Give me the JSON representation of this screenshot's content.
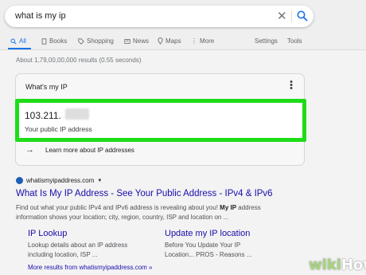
{
  "search": {
    "query": "what is my ip",
    "clear_glyph": "✕"
  },
  "tabs": [
    {
      "label": "All",
      "icon": "search-icon"
    },
    {
      "label": "Books",
      "icon": "book-icon"
    },
    {
      "label": "Shopping",
      "icon": "tag-icon"
    },
    {
      "label": "News",
      "icon": "news-icon"
    },
    {
      "label": "Maps",
      "icon": "map-pin-icon"
    },
    {
      "label": "More",
      "icon": "more-vert-icon"
    }
  ],
  "tools": {
    "settings": "Settings",
    "tools": "Tools"
  },
  "stats": "About 1,79,00,00,000 results (0.55 seconds)",
  "card": {
    "title": "What's my IP",
    "ip_prefix": "103.211.",
    "ip_label": "Your public IP address",
    "learn_more": "Learn more about IP addresses"
  },
  "result": {
    "site": "whatismyipaddress.com",
    "title": "What Is My IP Address - See Your Public Address - IPv4 & IPv6",
    "snippet_line1_a": "Find out what your public IPv4 and IPv6 address is revealing about you! ",
    "snippet_line1_b": "My IP",
    "snippet_line1_c": " address",
    "snippet_line2": "information shows your location; city, region, country, ISP and location on ...",
    "sublinks": [
      {
        "title": "IP Lookup",
        "line1": "Lookup details about an IP address",
        "line2": "including location, ISP ..."
      },
      {
        "title": "Update my IP location",
        "line1": "Before You Update Your IP",
        "line2": "Location... PROS - Reasons ..."
      }
    ],
    "more_results": "More results from whatismyipaddress.com »"
  },
  "watermark": {
    "a": "wiki",
    "b": "How"
  },
  "colors": {
    "highlight": "#1fdc19",
    "link": "#1a0dab",
    "accent": "#1a73e8"
  }
}
